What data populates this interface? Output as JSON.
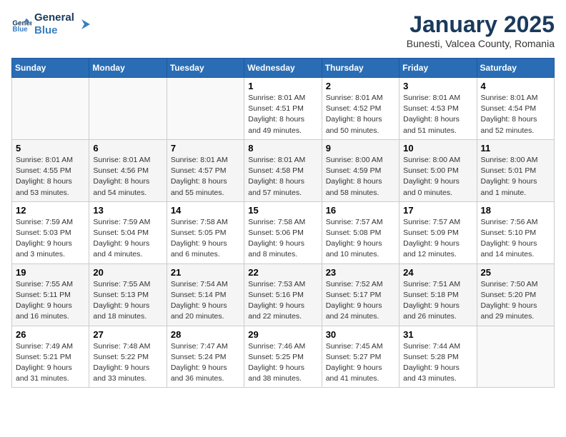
{
  "header": {
    "logo_line1": "General",
    "logo_line2": "Blue",
    "title": "January 2025",
    "subtitle": "Bunesti, Valcea County, Romania"
  },
  "weekdays": [
    "Sunday",
    "Monday",
    "Tuesday",
    "Wednesday",
    "Thursday",
    "Friday",
    "Saturday"
  ],
  "weeks": [
    [
      {
        "day": "",
        "info": ""
      },
      {
        "day": "",
        "info": ""
      },
      {
        "day": "",
        "info": ""
      },
      {
        "day": "1",
        "info": "Sunrise: 8:01 AM\nSunset: 4:51 PM\nDaylight: 8 hours\nand 49 minutes."
      },
      {
        "day": "2",
        "info": "Sunrise: 8:01 AM\nSunset: 4:52 PM\nDaylight: 8 hours\nand 50 minutes."
      },
      {
        "day": "3",
        "info": "Sunrise: 8:01 AM\nSunset: 4:53 PM\nDaylight: 8 hours\nand 51 minutes."
      },
      {
        "day": "4",
        "info": "Sunrise: 8:01 AM\nSunset: 4:54 PM\nDaylight: 8 hours\nand 52 minutes."
      }
    ],
    [
      {
        "day": "5",
        "info": "Sunrise: 8:01 AM\nSunset: 4:55 PM\nDaylight: 8 hours\nand 53 minutes."
      },
      {
        "day": "6",
        "info": "Sunrise: 8:01 AM\nSunset: 4:56 PM\nDaylight: 8 hours\nand 54 minutes."
      },
      {
        "day": "7",
        "info": "Sunrise: 8:01 AM\nSunset: 4:57 PM\nDaylight: 8 hours\nand 55 minutes."
      },
      {
        "day": "8",
        "info": "Sunrise: 8:01 AM\nSunset: 4:58 PM\nDaylight: 8 hours\nand 57 minutes."
      },
      {
        "day": "9",
        "info": "Sunrise: 8:00 AM\nSunset: 4:59 PM\nDaylight: 8 hours\nand 58 minutes."
      },
      {
        "day": "10",
        "info": "Sunrise: 8:00 AM\nSunset: 5:00 PM\nDaylight: 9 hours\nand 0 minutes."
      },
      {
        "day": "11",
        "info": "Sunrise: 8:00 AM\nSunset: 5:01 PM\nDaylight: 9 hours\nand 1 minute."
      }
    ],
    [
      {
        "day": "12",
        "info": "Sunrise: 7:59 AM\nSunset: 5:03 PM\nDaylight: 9 hours\nand 3 minutes."
      },
      {
        "day": "13",
        "info": "Sunrise: 7:59 AM\nSunset: 5:04 PM\nDaylight: 9 hours\nand 4 minutes."
      },
      {
        "day": "14",
        "info": "Sunrise: 7:58 AM\nSunset: 5:05 PM\nDaylight: 9 hours\nand 6 minutes."
      },
      {
        "day": "15",
        "info": "Sunrise: 7:58 AM\nSunset: 5:06 PM\nDaylight: 9 hours\nand 8 minutes."
      },
      {
        "day": "16",
        "info": "Sunrise: 7:57 AM\nSunset: 5:08 PM\nDaylight: 9 hours\nand 10 minutes."
      },
      {
        "day": "17",
        "info": "Sunrise: 7:57 AM\nSunset: 5:09 PM\nDaylight: 9 hours\nand 12 minutes."
      },
      {
        "day": "18",
        "info": "Sunrise: 7:56 AM\nSunset: 5:10 PM\nDaylight: 9 hours\nand 14 minutes."
      }
    ],
    [
      {
        "day": "19",
        "info": "Sunrise: 7:55 AM\nSunset: 5:11 PM\nDaylight: 9 hours\nand 16 minutes."
      },
      {
        "day": "20",
        "info": "Sunrise: 7:55 AM\nSunset: 5:13 PM\nDaylight: 9 hours\nand 18 minutes."
      },
      {
        "day": "21",
        "info": "Sunrise: 7:54 AM\nSunset: 5:14 PM\nDaylight: 9 hours\nand 20 minutes."
      },
      {
        "day": "22",
        "info": "Sunrise: 7:53 AM\nSunset: 5:16 PM\nDaylight: 9 hours\nand 22 minutes."
      },
      {
        "day": "23",
        "info": "Sunrise: 7:52 AM\nSunset: 5:17 PM\nDaylight: 9 hours\nand 24 minutes."
      },
      {
        "day": "24",
        "info": "Sunrise: 7:51 AM\nSunset: 5:18 PM\nDaylight: 9 hours\nand 26 minutes."
      },
      {
        "day": "25",
        "info": "Sunrise: 7:50 AM\nSunset: 5:20 PM\nDaylight: 9 hours\nand 29 minutes."
      }
    ],
    [
      {
        "day": "26",
        "info": "Sunrise: 7:49 AM\nSunset: 5:21 PM\nDaylight: 9 hours\nand 31 minutes."
      },
      {
        "day": "27",
        "info": "Sunrise: 7:48 AM\nSunset: 5:22 PM\nDaylight: 9 hours\nand 33 minutes."
      },
      {
        "day": "28",
        "info": "Sunrise: 7:47 AM\nSunset: 5:24 PM\nDaylight: 9 hours\nand 36 minutes."
      },
      {
        "day": "29",
        "info": "Sunrise: 7:46 AM\nSunset: 5:25 PM\nDaylight: 9 hours\nand 38 minutes."
      },
      {
        "day": "30",
        "info": "Sunrise: 7:45 AM\nSunset: 5:27 PM\nDaylight: 9 hours\nand 41 minutes."
      },
      {
        "day": "31",
        "info": "Sunrise: 7:44 AM\nSunset: 5:28 PM\nDaylight: 9 hours\nand 43 minutes."
      },
      {
        "day": "",
        "info": ""
      }
    ]
  ]
}
